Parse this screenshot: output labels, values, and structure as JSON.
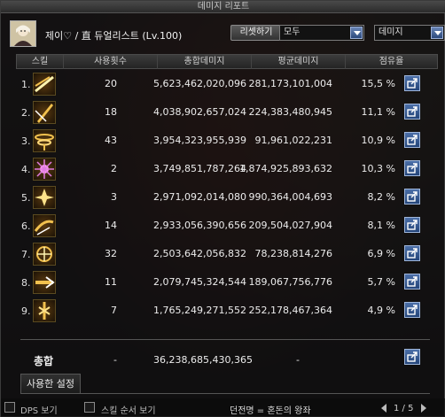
{
  "window": {
    "title": "데미지 리포트"
  },
  "character": {
    "name_label": "제이♡ / 直 듀얼리스트 (Lv.100)"
  },
  "controls": {
    "reset_label": "리셋하기",
    "filter_value": "모두",
    "sort_value": "데미지"
  },
  "columns": {
    "skill": "스킬",
    "uses": "사용횟수",
    "total": "총합데미지",
    "avg": "평균데미지",
    "share": "점유율"
  },
  "rows": [
    {
      "idx": "1.",
      "uses": "20",
      "total": "5,623,462,020,096",
      "avg": "281,173,101,004",
      "share": "15,5 %",
      "icon": "slash-skill-icon"
    },
    {
      "idx": "2.",
      "uses": "18",
      "total": "4,038,902,657,024",
      "avg": "224,383,480,945",
      "share": "11,1 %",
      "icon": "blade-skill-icon"
    },
    {
      "idx": "3.",
      "uses": "43",
      "total": "3,954,323,955,939",
      "avg": "91,961,022,231",
      "share": "10,9 %",
      "icon": "whirlwind-skill-icon"
    },
    {
      "idx": "4.",
      "uses": "2",
      "total": "3,749,851,787,264",
      "avg": "1,874,925,893,632",
      "share": "10,3 %",
      "icon": "burst-skill-icon"
    },
    {
      "idx": "5.",
      "uses": "3",
      "total": "2,971,092,014,080",
      "avg": "990,364,004,693",
      "share": "8,2 %",
      "icon": "flash-skill-icon"
    },
    {
      "idx": "6.",
      "uses": "14",
      "total": "2,933,056,390,656",
      "avg": "209,504,027,904",
      "share": "8,1 %",
      "icon": "dash-skill-icon"
    },
    {
      "idx": "7.",
      "uses": "32",
      "total": "2,503,642,056,832",
      "avg": "78,238,814,276",
      "share": "6,9 %",
      "icon": "spark-skill-icon"
    },
    {
      "idx": "8.",
      "uses": "11",
      "total": "2,079,745,324,544",
      "avg": "189,067,756,776",
      "share": "5,7 %",
      "icon": "thrust-skill-icon"
    },
    {
      "idx": "9.",
      "uses": "7",
      "total": "1,765,249,271,552",
      "avg": "252,178,467,364",
      "share": "4,9 %",
      "icon": "chain-skill-icon"
    }
  ],
  "summary": {
    "label": "총합",
    "uses": "-",
    "total": "36,238,685,430,365",
    "avg": "-"
  },
  "tabs": {
    "settings": "사용한 설정"
  },
  "footer": {
    "dps_label": "DPS 보기",
    "skill_order_label": "스킬 순서 보기",
    "title_text": "던전명 = 혼돈의 왕좌",
    "page": "1 / 5"
  },
  "colors": {
    "accent": "#2c4a7d",
    "gold": "#f2c14e"
  }
}
